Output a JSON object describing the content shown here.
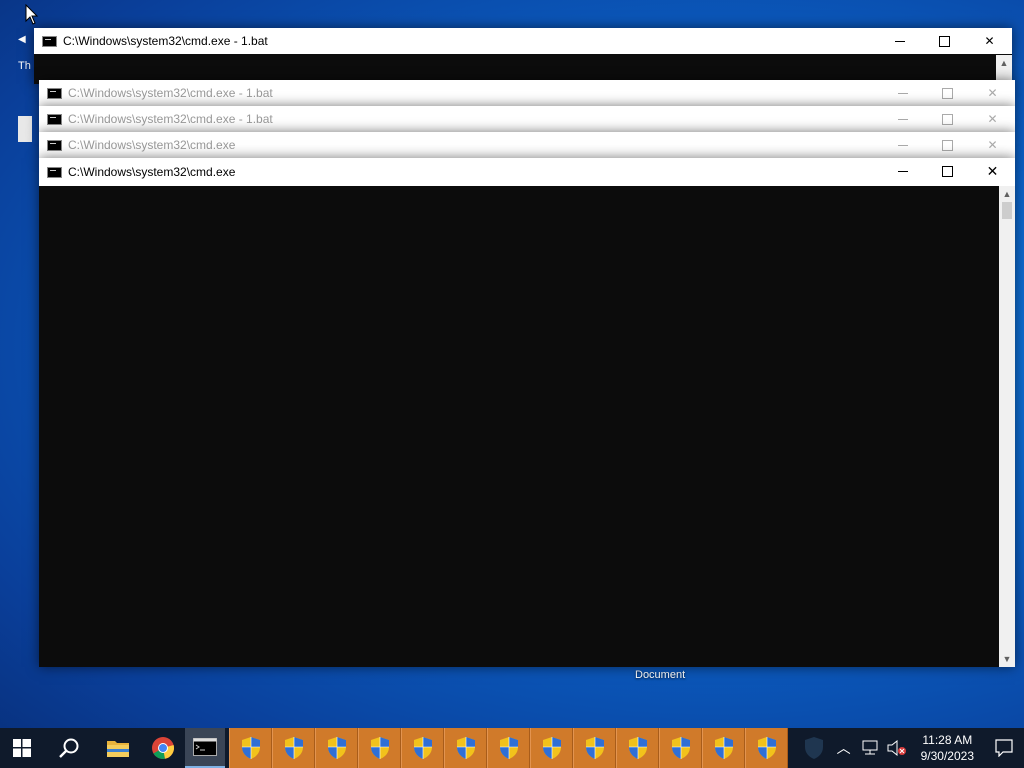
{
  "desktop": {
    "peek_text": "Th",
    "document_label": "Document"
  },
  "windows": [
    {
      "title": "C:\\Windows\\system32\\cmd.exe - 1.bat",
      "active": true
    },
    {
      "title": "C:\\Windows\\system32\\cmd.exe - 1.bat",
      "active": false
    },
    {
      "title": "C:\\Windows\\system32\\cmd.exe - 1.bat",
      "active": false
    },
    {
      "title": "C:\\Windows\\system32\\cmd.exe",
      "active": false
    },
    {
      "title": "C:\\Windows\\system32\\cmd.exe",
      "active": true
    }
  ],
  "taskbar": {
    "icons": [
      "windows-start-icon",
      "search-icon",
      "file-explorer-icon",
      "chrome-icon",
      "cmd-icon"
    ],
    "shield_count": 13,
    "time": "11:28 AM",
    "date": "9/30/2023"
  },
  "colors": {
    "accent": "#0b63c9",
    "taskbar": "#0f1a2b",
    "shield_tile": "#d07a2a"
  }
}
